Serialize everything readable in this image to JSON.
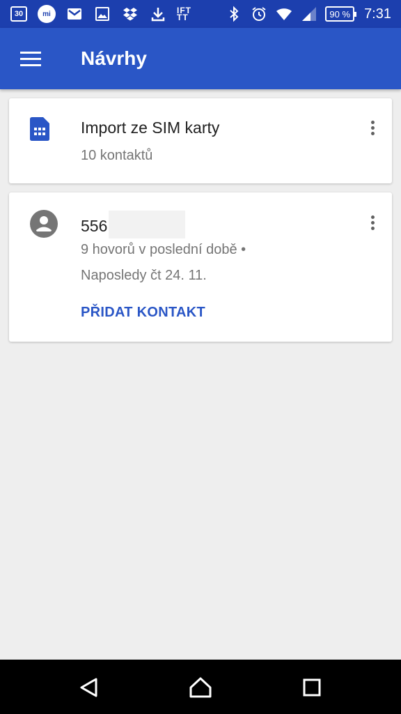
{
  "status_bar": {
    "calendar_day": "30",
    "mi_label": "mi",
    "ift_label": "IFT TT",
    "battery": "90 %",
    "time": "7:31",
    "icons": [
      "calendar-icon",
      "mi-icon",
      "gmail-icon",
      "gallery-icon",
      "dropbox-icon",
      "download-icon",
      "ifttt-icon",
      "bluetooth-icon",
      "alarm-icon",
      "wifi-icon",
      "signal-icon",
      "battery-icon"
    ]
  },
  "app_bar": {
    "title": "Návrhy"
  },
  "cards": [
    {
      "icon": "sim-card-icon",
      "title": "Import ze SIM karty",
      "subtitle": "10 kontaktů"
    },
    {
      "icon": "person-avatar-icon",
      "title": "556",
      "line1": "9 hovorů v poslední době •",
      "line2": "Naposledy čt 24. 11.",
      "action": "PŘIDAT KONTAKT"
    }
  ],
  "colors": {
    "status_bar": "#1c3fae",
    "app_bar": "#2a56c6",
    "accent": "#2a56c6",
    "background": "#eeeeee"
  }
}
